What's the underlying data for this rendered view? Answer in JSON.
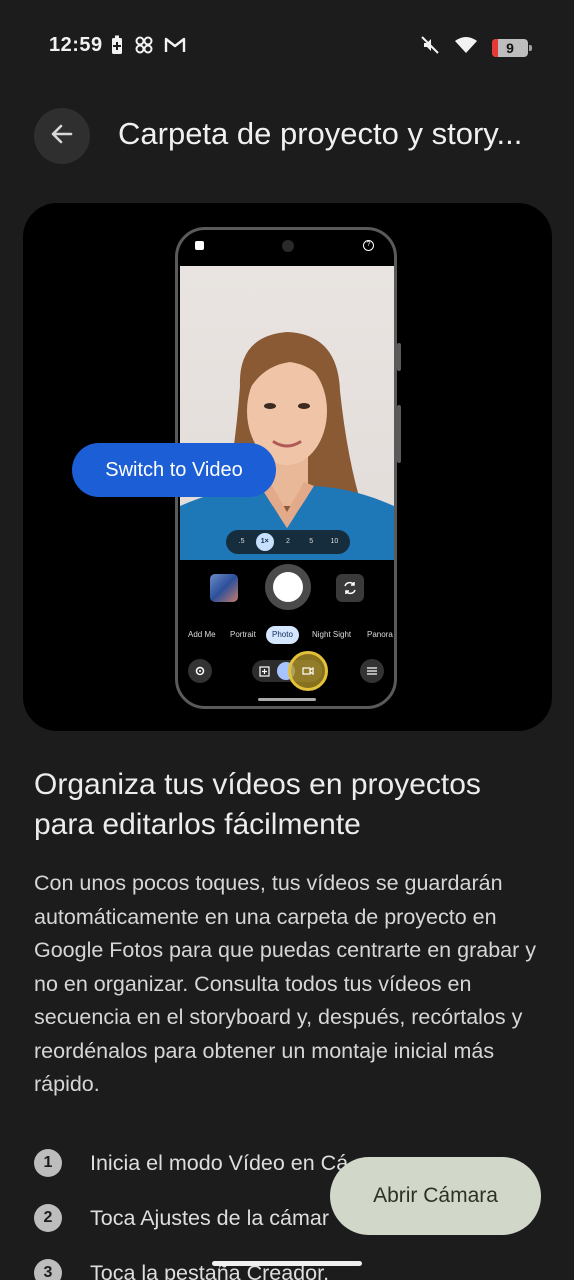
{
  "status_bar": {
    "time": "12:59",
    "battery_level": "9"
  },
  "header": {
    "title": "Carpeta de proyecto y story..."
  },
  "hero": {
    "chip_label": "Switch to Video",
    "zoom_options": [
      ".5",
      "1×",
      "2",
      "5",
      "10"
    ],
    "modes": [
      "Add Me",
      "Portrait",
      "Photo",
      "Night Sight",
      "Panora"
    ]
  },
  "content": {
    "heading": "Organiza tus vídeos en proyectos para editarlos fácilmente",
    "body": "Con unos pocos toques, tus vídeos se guardarán automáticamente en una carpeta de proyecto en Google Fotos para que puedas centrarte en grabar y no en organizar. Consulta todos tus vídeos en secuencia en el storyboard y, después, recórtalos y reordénalos para obtener un montaje inicial más rápido.",
    "steps": [
      {
        "num": "1",
        "text": "Inicia el modo Vídeo en Cá"
      },
      {
        "num": "2",
        "text": "Toca Ajustes de la cámar"
      },
      {
        "num": "3",
        "text": "Toca la pestaña Creador."
      }
    ]
  },
  "fab": {
    "label": "Abrir Cámara"
  },
  "colors": {
    "background": "#1c1c1c",
    "chip": "#1b5ed6",
    "fab": "#d2d8c9",
    "highlight": "#e3c13a"
  }
}
